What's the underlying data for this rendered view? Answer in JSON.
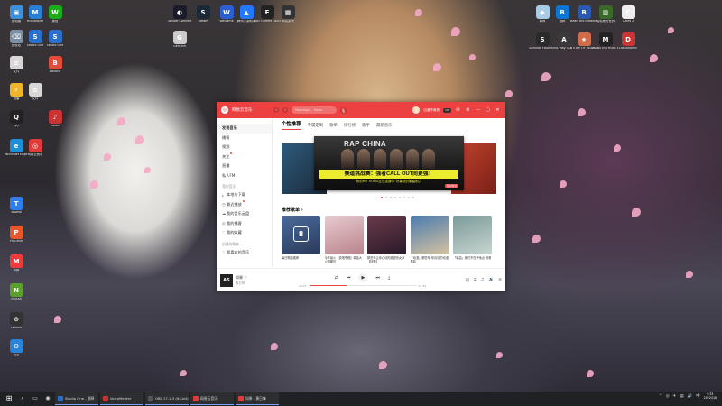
{
  "desktop": {
    "icons": [
      {
        "id": "left-1",
        "label": "此电脑",
        "color": "#3e8fd9",
        "glyph": "▣"
      },
      {
        "id": "left-2",
        "label": "Multiplayer",
        "color": "#2a7fd4",
        "glyph": "M"
      },
      {
        "id": "left-3",
        "label": "微信",
        "color": "#1aad19",
        "glyph": "W"
      },
      {
        "id": "left-4",
        "label": "回收站",
        "color": "#7c8ea6",
        "glyph": "⌫"
      },
      {
        "id": "left-5",
        "label": "Studio One",
        "color": "#2a6fc9",
        "glyph": "S"
      },
      {
        "id": "left-6",
        "label": "Studio One",
        "color": "#2a6fc9",
        "glyph": "S"
      },
      {
        "id": "left-7",
        "label": "文件",
        "color": "#d7d7d7",
        "glyph": "≡"
      },
      {
        "id": "left-8",
        "label": "Banana",
        "color": "#e34b3b",
        "glyph": "B"
      },
      {
        "id": "left-9",
        "label": "迅雷",
        "color": "#f0b429",
        "glyph": "⚡"
      },
      {
        "id": "left-10",
        "label": "文件",
        "color": "#d7d7d7",
        "glyph": "≡"
      },
      {
        "id": "left-11",
        "label": "QQ",
        "color": "#222",
        "glyph": "Q"
      },
      {
        "id": "left-12",
        "label": "Steam",
        "color": "#c33",
        "glyph": "♪"
      },
      {
        "id": "left-13",
        "label": "Microsoft Edge",
        "color": "#1d8fd6",
        "glyph": "e"
      },
      {
        "id": "left-14",
        "label": "网易云音乐",
        "color": "#e03a3a",
        "glyph": "◎"
      },
      {
        "id": "left-15",
        "label": "ToDesk",
        "color": "#2d7ff0",
        "glyph": "T"
      },
      {
        "id": "left-16",
        "label": "ProDrive",
        "color": "#e8572c",
        "glyph": "P"
      },
      {
        "id": "left-17",
        "label": "剪映",
        "color": "#ef3a3a",
        "glyph": "M"
      },
      {
        "id": "left-18",
        "label": "NVIDIA",
        "color": "#5aa02c",
        "glyph": "N"
      },
      {
        "id": "left-19",
        "label": "Lenovo",
        "color": "#333",
        "glyph": "⊙"
      },
      {
        "id": "left-20",
        "label": "迅游",
        "color": "#2b83d8",
        "glyph": "⚙"
      },
      {
        "id": "top-1",
        "label": "Ubisoft Connect",
        "color": "#1a1a2a",
        "glyph": "◐"
      },
      {
        "id": "top-2",
        "label": "Steam",
        "color": "#1b2838",
        "glyph": "S"
      },
      {
        "id": "top-3",
        "label": "WeGame",
        "color": "#2a5fd0",
        "glyph": "W"
      },
      {
        "id": "top-4",
        "label": "腾讯手游助手",
        "color": "#2478ff",
        "glyph": "▲"
      },
      {
        "id": "top-5",
        "label": "Epic Games Launcher",
        "color": "#222",
        "glyph": "E"
      },
      {
        "id": "top-6",
        "label": "网易游戏",
        "color": "#333",
        "glyph": "▦"
      },
      {
        "id": "top-7",
        "label": "Genshin",
        "color": "#ccc",
        "glyph": "G"
      },
      {
        "id": "right-1",
        "label": "原神",
        "color": "#a9cbe6",
        "glyph": "◆"
      },
      {
        "id": "right-2",
        "label": "战网",
        "color": "#0a76d8",
        "glyph": "B"
      },
      {
        "id": "right-3",
        "label": "Bear and Breakfast",
        "color": "#2a5ab0",
        "glyph": "B"
      },
      {
        "id": "right-4",
        "label": "哈哈我的世界",
        "color": "#3a6a2a",
        "glyph": "▥"
      },
      {
        "id": "right-5",
        "label": "Cities 2",
        "color": "#eee",
        "glyph": "C"
      },
      {
        "id": "right-6",
        "label": "Survival Fountain",
        "color": "#2a2a2a",
        "glyph": "S"
      },
      {
        "id": "right-7",
        "label": "A Way Out",
        "color": "#3a3a3a",
        "glyph": "A"
      },
      {
        "id": "right-8",
        "label": "STORY OF SEASONS",
        "color": "#d06c4a",
        "glyph": "★"
      },
      {
        "id": "right-9",
        "label": "MONSTER HUNTER",
        "color": "#222",
        "glyph": "M"
      },
      {
        "id": "right-10",
        "label": "Dishonored",
        "color": "#c33",
        "glyph": "D"
      }
    ]
  },
  "app": {
    "name": "网易云音乐",
    "search_placeholder": "Moonlight - Swan",
    "user_name": "出道不爽的",
    "vip": "VIP",
    "window_btns": [
      "✉",
      "⚙",
      "—",
      "▢",
      "✕"
    ],
    "nav": {
      "back": "‹",
      "forward": "›",
      "mic": "🎙"
    },
    "sidebar": {
      "items": [
        {
          "label": "发现音乐",
          "active": true
        },
        {
          "label": "播客"
        },
        {
          "label": "视频"
        },
        {
          "label": "关注",
          "dot": true
        },
        {
          "label": "直播"
        },
        {
          "label": "私人FM"
        }
      ],
      "my_music_header": "我的音乐",
      "my_items": [
        {
          "icon": "⤓",
          "label": "本地与下载"
        },
        {
          "icon": "◷",
          "label": "最近播放",
          "dot": true
        },
        {
          "icon": "☁",
          "label": "我的音乐云盘"
        },
        {
          "icon": "◎",
          "label": "我的播客"
        },
        {
          "icon": "♡",
          "label": "我的收藏"
        }
      ],
      "created_header": "创建的歌单 ⌄",
      "created_items": [
        {
          "icon": "♡",
          "label": "我喜欢的音乐"
        }
      ]
    },
    "tabs": [
      {
        "label": "个性推荐",
        "active": true
      },
      {
        "label": "专属定制"
      },
      {
        "label": "歌单"
      },
      {
        "label": "排行榜"
      },
      {
        "label": "歌手"
      },
      {
        "label": "最新音乐"
      }
    ],
    "banner": {
      "brand": "RAP CHINA",
      "headline": "赛道挑战赛：强者CALL OUT向更强！",
      "sub": "你的HIT SONG正在发酵中  为喜欢的歌曲助力",
      "badge": "独家策划"
    },
    "recommended": {
      "title": "推荐歌单 ›",
      "playlists": [
        {
          "name": "每日歌曲推荐",
          "date_badge": "8",
          "colors": [
            "#4a6a9a",
            "#2a3a5a"
          ]
        },
        {
          "name": "今年最火【说唱专辑】单曲大人物都在",
          "colors": [
            "#e7cbd0",
            "#b9838a"
          ]
        },
        {
          "name": "那些年让你心动的超甜系女声【情歌】",
          "colors": [
            "#6a3a4a",
            "#2a1a2a"
          ]
        },
        {
          "name": "「动漫」那些年 你喜欢的动漫歌曲",
          "colors": [
            "#4a7ab0",
            "#d6c3a0"
          ]
        },
        {
          "name": "「单曲」我们不在乎地点 别看",
          "colors": [
            "#7a9a9a",
            "#c8d6cf"
          ]
        }
      ]
    },
    "player": {
      "art_label": "AS",
      "song": "如果 ♡",
      "artist": "黄日锋",
      "time_current": "00:07",
      "time_total": "04:26",
      "progress": 0.35,
      "buttons": [
        "⇄",
        "⏮",
        "▶",
        "⏭",
        "⤓"
      ],
      "extras": [
        "词",
        "⌸",
        "♫",
        "🔊",
        "≡"
      ]
    }
  },
  "taskbar": {
    "start": "⊞",
    "pinned": [
      "⌕",
      "▭",
      "◉"
    ],
    "items": [
      {
        "label": "Studio One - 钢琴",
        "color": "#2a6fc9"
      },
      {
        "label": "VoiceMeeter",
        "color": "#c33"
      },
      {
        "label": "OBS 27.1.3 (64-bit)",
        "color": "#555"
      },
      {
        "label": "网易云音乐",
        "color": "#e03a3a"
      },
      {
        "label": "如果 - 黄日锋",
        "color": "#e03a3a"
      }
    ],
    "tray": [
      "⌃",
      "◎",
      "✈",
      "▤",
      "🔊",
      "中"
    ],
    "time": "9:33",
    "date": "2022/1/8"
  }
}
